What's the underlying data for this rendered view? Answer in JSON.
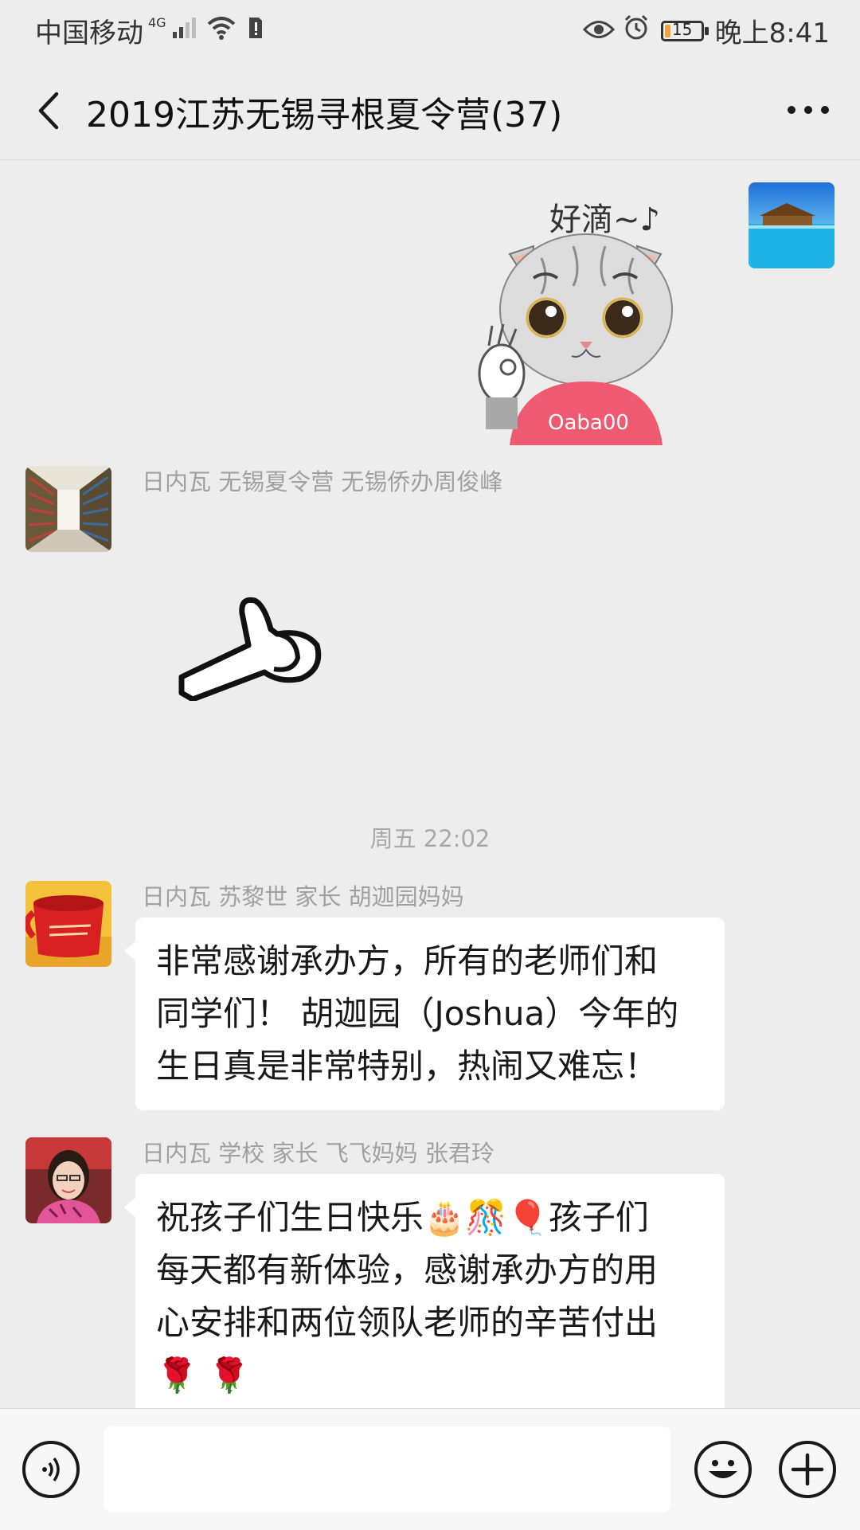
{
  "status_bar": {
    "carrier": "中国移动",
    "network": "4G",
    "battery_level": "15",
    "time": "晚上8:41"
  },
  "nav": {
    "title": "2019江苏无锡寻根夏令营(37)",
    "back_icon": "chevron-left-icon",
    "more_icon": "more-dots-icon"
  },
  "messages": [
    {
      "type": "sticker",
      "side": "self",
      "sticker_text": "好滴~♪",
      "sticker_shirt_text": "Oaba00",
      "avatar": "beach-resort-photo"
    },
    {
      "type": "sticker",
      "side": "other",
      "sender": "日内瓦 无锡夏令营 无锡侨办周俊峰",
      "avatar": "library-shelves-photo",
      "sticker": "thumbs-up-hand"
    },
    {
      "type": "timestamp",
      "text": "周五 22:02"
    },
    {
      "type": "text",
      "side": "other",
      "sender": "日内瓦 苏黎世 家长 胡迦园妈妈",
      "avatar": "red-mug-photo",
      "lines": [
        "非常感谢承办方，所有的老师们和",
        "同学们！ 胡迦园（Joshua）今年的",
        "生日真是非常特别，热闹又难忘！"
      ]
    },
    {
      "type": "text",
      "side": "other",
      "sender": "日内瓦 学校 家长 飞飞妈妈 张君玲",
      "avatar": "woman-portrait-photo",
      "lines": [
        "祝孩子们生日快乐🎂🎊🎈孩子们",
        "每天都有新体验，感谢承办方的用",
        "心安排和两位领队老师的辛苦付出",
        "🌹 🌹"
      ]
    }
  ],
  "input_bar": {
    "placeholder": "",
    "voice_icon": "voice-icon",
    "emoji_icon": "smiley-icon",
    "plus_icon": "plus-icon"
  },
  "colors": {
    "background": "#ededed",
    "bubble": "#ffffff",
    "sender_name": "#a0a0a0",
    "timestamp": "#a8a8a8"
  }
}
